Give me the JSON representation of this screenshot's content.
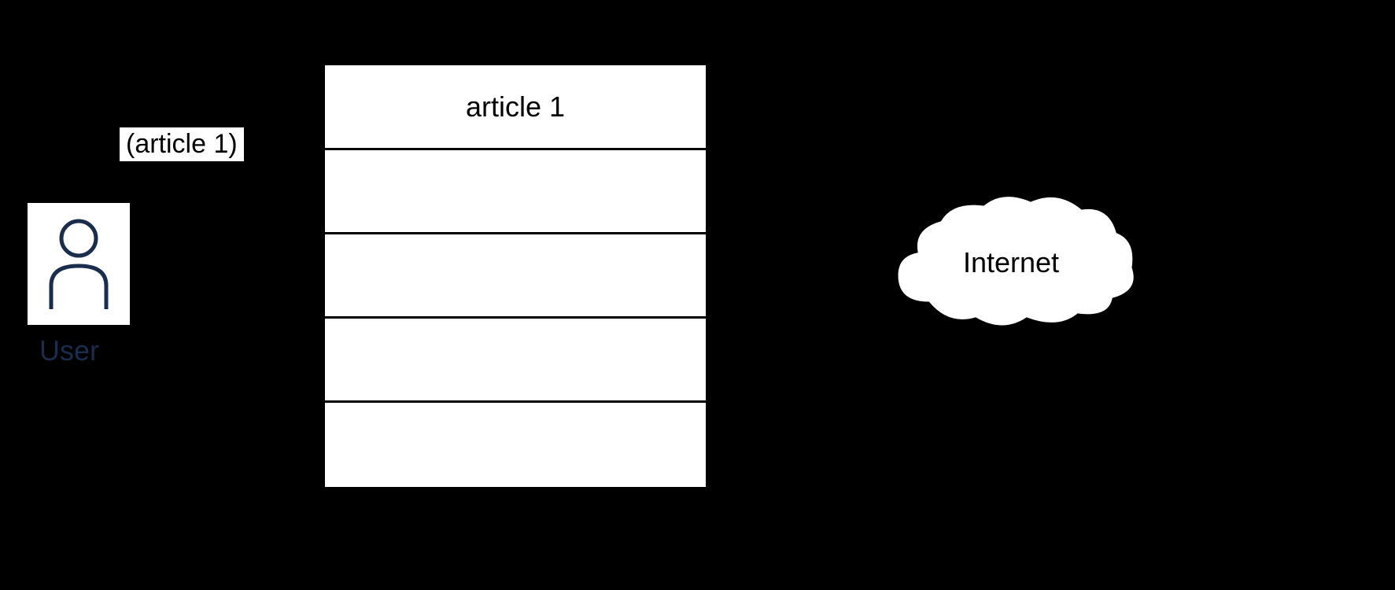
{
  "user": {
    "label": "User"
  },
  "link": {
    "text": "(article 1)"
  },
  "stack": {
    "header": "article 1",
    "rows": [
      "",
      "",
      "",
      ""
    ]
  },
  "cloud": {
    "label": "Internet"
  }
}
